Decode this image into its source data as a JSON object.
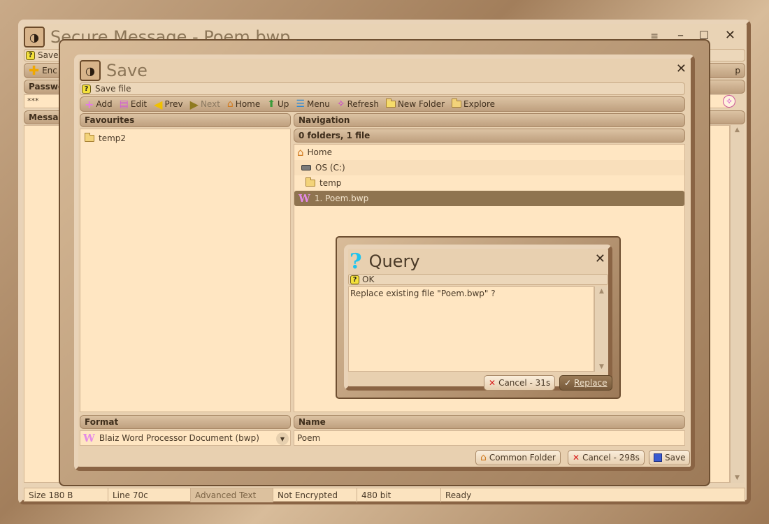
{
  "main_window": {
    "title": "Secure Message - Poem.bwp",
    "save_label": "Save",
    "enc_label": "Enc",
    "password_label": "Passwo",
    "password_value": "***",
    "message_label": "Messag",
    "right_stub": "p"
  },
  "status_bar": {
    "size": "Size 180 B",
    "line": "Line 70c",
    "mode": "Advanced Text",
    "encryption": "Not Encrypted",
    "bits": "480 bit",
    "state": "Ready"
  },
  "save_dialog": {
    "title": "Save",
    "subtitle": "Save file",
    "toolbar": {
      "add": "Add",
      "edit": "Edit",
      "prev": "Prev",
      "next": "Next",
      "home": "Home",
      "up": "Up",
      "menu": "Menu",
      "refresh": "Refresh",
      "new_folder": "New Folder",
      "explore": "Explore"
    },
    "favourites_header": "Favourites",
    "favourites": [
      "temp2"
    ],
    "navigation_header": "Navigation",
    "nav_summary": "0 folders, 1 file",
    "nav_items": [
      {
        "label": "Home"
      },
      {
        "label": "OS (C:)"
      },
      {
        "label": "temp"
      },
      {
        "label": "1. Poem.bwp"
      }
    ],
    "format_header": "Format",
    "format_value": "Blaiz Word Processor Document (bwp)",
    "name_header": "Name",
    "name_value": "Poem",
    "buttons": {
      "common_folder": "Common Folder",
      "cancel": "Cancel - 298s",
      "save": "Save"
    }
  },
  "query_dialog": {
    "title": "Query",
    "subtitle": "OK",
    "message": "Replace existing file \"Poem.bwp\" ?",
    "cancel": "Cancel - 31s",
    "replace": "Replace"
  },
  "colors": {
    "accent": "#8a6444",
    "panel": "#ffe6c2",
    "selected": "#8f7450"
  }
}
